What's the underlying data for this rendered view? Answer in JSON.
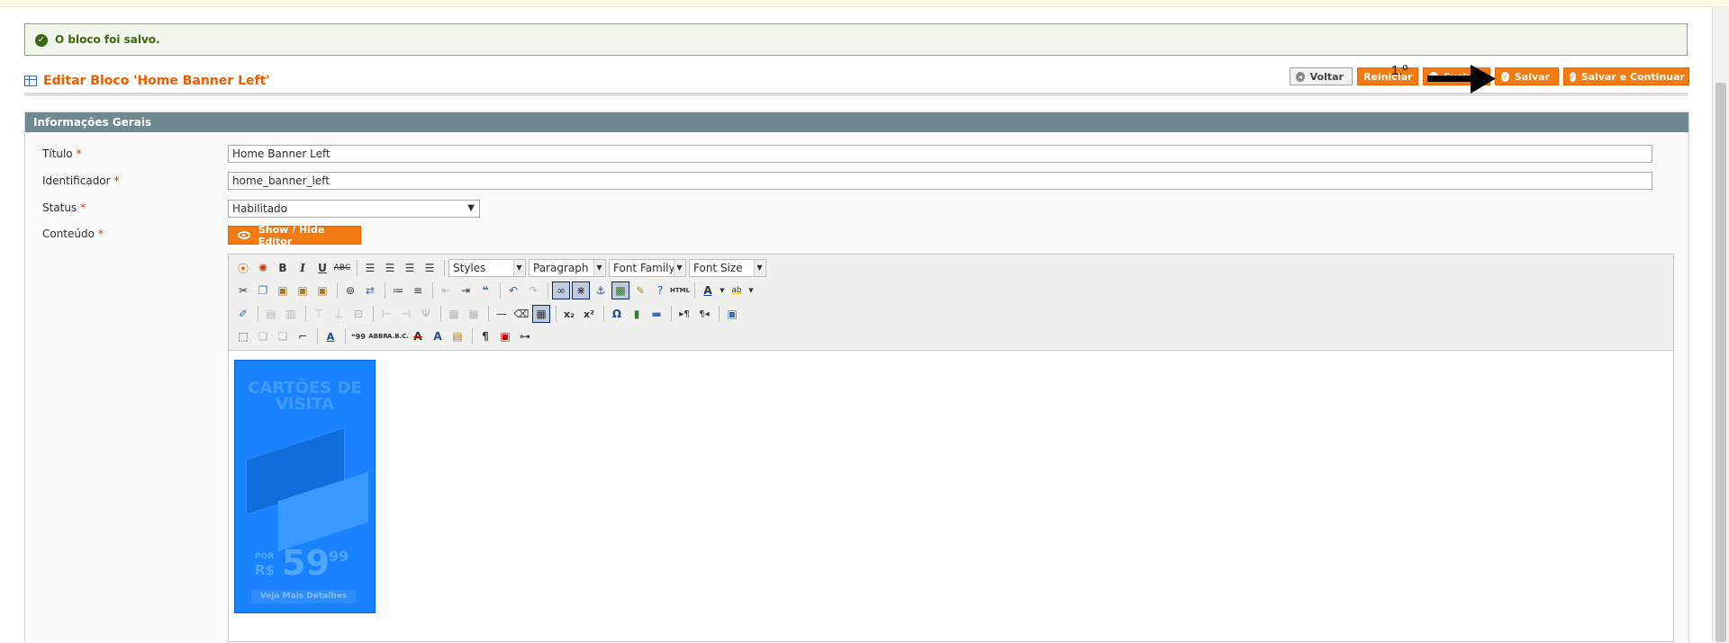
{
  "message": {
    "text": "O bloco foi salvo."
  },
  "header": {
    "title": "Editar Bloco 'Home Banner Left'"
  },
  "buttons": {
    "back": "Voltar",
    "reset": "Reiniciar",
    "delete": "Excluir",
    "save": "Salvar",
    "save_continue": "Salvar e Continuar"
  },
  "annotation": {
    "label": "1.º"
  },
  "section": {
    "title": "Informações Gerais"
  },
  "form": {
    "required_mark": "*",
    "title_label": "Título",
    "title_value": "Home Banner Left",
    "identifier_label": "Identificador",
    "identifier_value": "home_banner_left",
    "status_label": "Status",
    "status_value": "Habilitado",
    "content_label": "Conteúdo",
    "show_hide_label": "Show / Hide Editor"
  },
  "editor": {
    "dropdowns": {
      "styles": "Styles",
      "format": "Paragraph",
      "font_family": "Font Family",
      "font_size": "Font Size"
    }
  },
  "banner": {
    "headline_1": "CARTÕES DE",
    "headline_2": "VISITA",
    "por": "POR",
    "currency": "R$",
    "price": "59",
    "cents": "99",
    "cta": "Veja Mais Detalhes"
  }
}
